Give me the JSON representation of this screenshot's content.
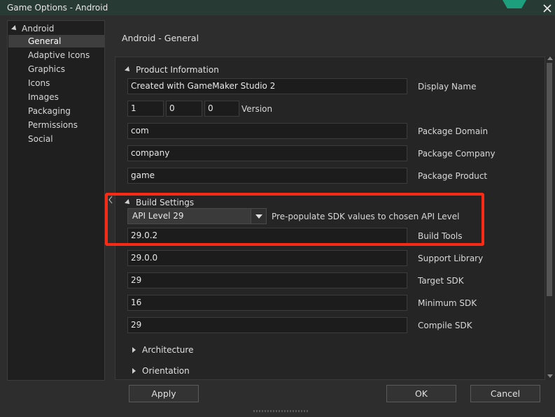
{
  "window": {
    "title": "Game Options - Android"
  },
  "sidebar": {
    "root": "Android",
    "items": [
      {
        "label": "General",
        "selected": true
      },
      {
        "label": "Adaptive Icons"
      },
      {
        "label": "Graphics"
      },
      {
        "label": "Icons"
      },
      {
        "label": "Images"
      },
      {
        "label": "Packaging"
      },
      {
        "label": "Permissions"
      },
      {
        "label": "Social"
      }
    ]
  },
  "main": {
    "title": "Android - General",
    "product": {
      "heading": "Product Information",
      "display_name": {
        "value": "Created with GameMaker Studio 2",
        "label": "Display Name"
      },
      "version": {
        "major": "1",
        "minor": "0",
        "patch": "0",
        "label": "Version"
      },
      "package_domain": {
        "value": "com",
        "label": "Package Domain"
      },
      "package_company": {
        "value": "company",
        "label": "Package Company"
      },
      "package_product": {
        "value": "game",
        "label": "Package Product"
      }
    },
    "build": {
      "heading": "Build Settings",
      "api_level": {
        "selected": "API Level 29",
        "label": "Pre-populate SDK values to chosen API Level"
      },
      "build_tools": {
        "value": "29.0.2",
        "label": "Build Tools"
      },
      "support_library": {
        "value": "29.0.0",
        "label": "Support Library"
      },
      "target_sdk": {
        "value": "29",
        "label": "Target SDK"
      },
      "minimum_sdk": {
        "value": "16",
        "label": "Minimum SDK"
      },
      "compile_sdk": {
        "value": "29",
        "label": "Compile SDK"
      }
    },
    "architecture": {
      "heading": "Architecture"
    },
    "orientation": {
      "heading": "Orientation"
    }
  },
  "buttons": {
    "apply": "Apply",
    "ok": "OK",
    "cancel": "Cancel"
  },
  "colors": {
    "highlight": "#ff2a14",
    "accent": "#1d9e7c"
  }
}
